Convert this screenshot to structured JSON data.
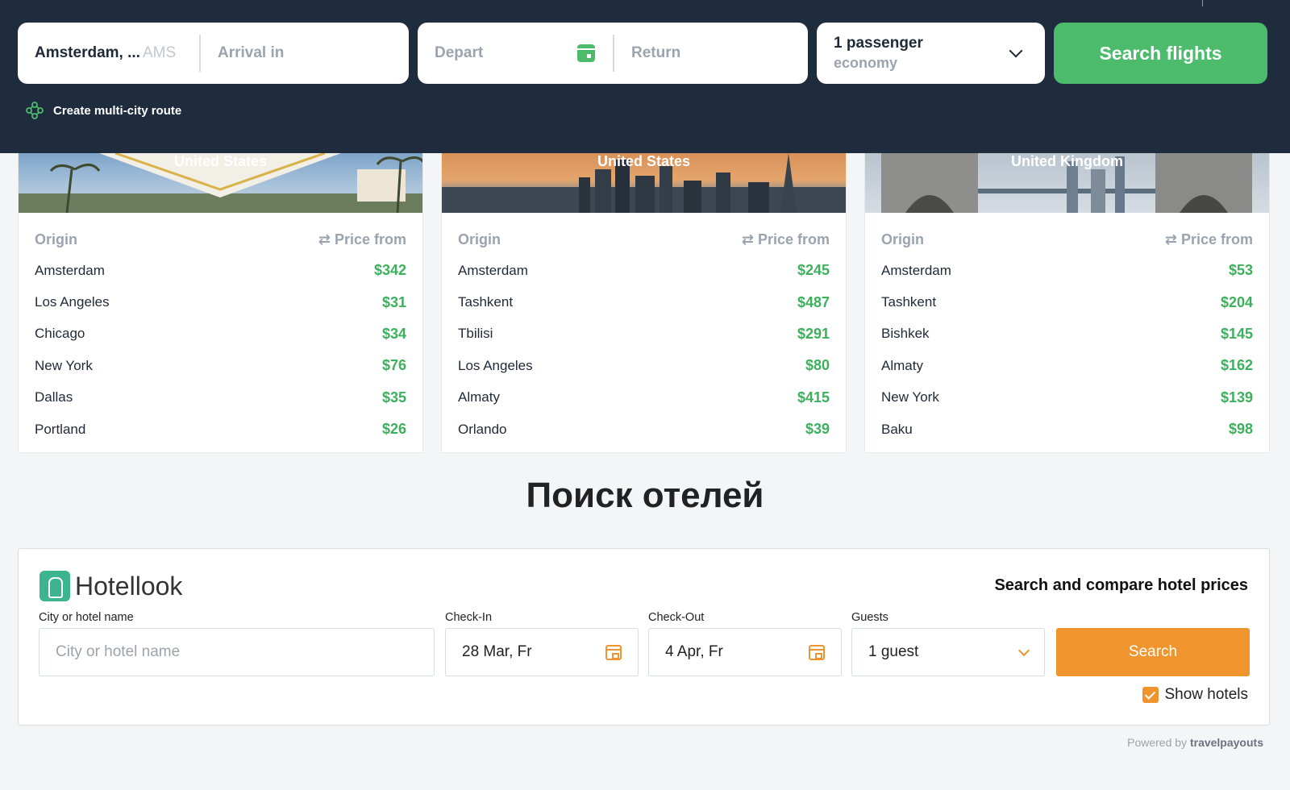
{
  "flight_search": {
    "origin_value": "Amsterdam, ...",
    "origin_iata": "AMS",
    "arrival_placeholder": "Arrival in",
    "depart_placeholder": "Depart",
    "return_placeholder": "Return",
    "passengers": "1 passenger",
    "cabin_class": "economy",
    "search_label": "Search flights",
    "multi_city_label": "Create multi-city route",
    "accent_color": "#4cbb6c"
  },
  "route_cards": [
    {
      "country": "United States",
      "origin_header": "Origin",
      "price_header": "Price from",
      "rows": [
        {
          "city": "Amsterdam",
          "price": "$342"
        },
        {
          "city": "Los Angeles",
          "price": "$31"
        },
        {
          "city": "Chicago",
          "price": "$34"
        },
        {
          "city": "New York",
          "price": "$76"
        },
        {
          "city": "Dallas",
          "price": "$35"
        },
        {
          "city": "Portland",
          "price": "$26"
        }
      ]
    },
    {
      "country": "United States",
      "origin_header": "Origin",
      "price_header": "Price from",
      "rows": [
        {
          "city": "Amsterdam",
          "price": "$245"
        },
        {
          "city": "Tashkent",
          "price": "$487"
        },
        {
          "city": "Tbilisi",
          "price": "$291"
        },
        {
          "city": "Los Angeles",
          "price": "$80"
        },
        {
          "city": "Almaty",
          "price": "$415"
        },
        {
          "city": "Orlando",
          "price": "$39"
        }
      ]
    },
    {
      "country": "United Kingdom",
      "origin_header": "Origin",
      "price_header": "Price from",
      "rows": [
        {
          "city": "Amsterdam",
          "price": "$53"
        },
        {
          "city": "Tashkent",
          "price": "$204"
        },
        {
          "city": "Bishkek",
          "price": "$145"
        },
        {
          "city": "Almaty",
          "price": "$162"
        },
        {
          "city": "New York",
          "price": "$139"
        },
        {
          "city": "Baku",
          "price": "$98"
        }
      ]
    }
  ],
  "hotels": {
    "section_title": "Поиск отелей",
    "brand": "Hotellook",
    "tagline": "Search and compare hotel prices",
    "city_label": "City or hotel name",
    "city_placeholder": "City or hotel name",
    "checkin_label": "Check-In",
    "checkin_value": "28 Mar, Fr",
    "checkout_label": "Check-Out",
    "checkout_value": "4 Apr, Fr",
    "guests_label": "Guests",
    "guests_value": "1 guest",
    "search_label": "Search",
    "show_hotels_label": "Show hotels",
    "accent_color": "#f0942e"
  },
  "footer": {
    "powered_prefix": "Powered by",
    "powered_brand": "travelpayouts"
  }
}
